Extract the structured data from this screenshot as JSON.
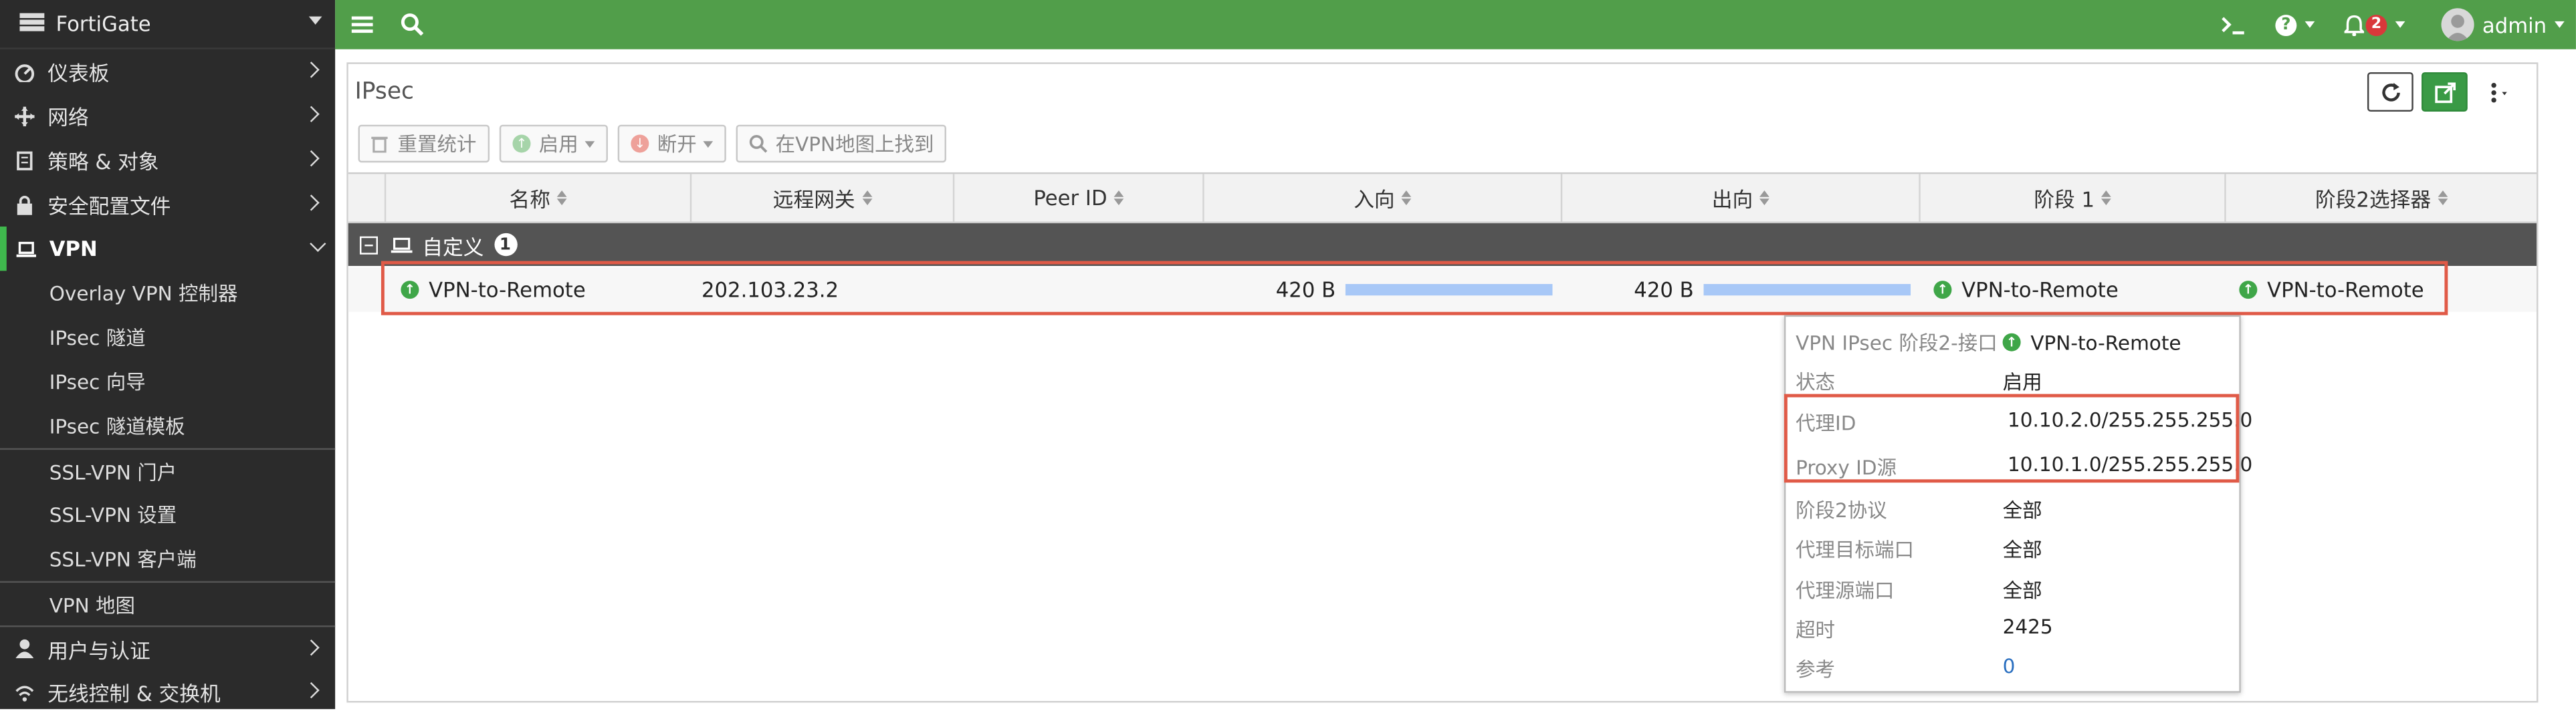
{
  "sidebar": {
    "brand": "FortiGate",
    "items": [
      {
        "label": "仪表板",
        "icon": "dashboard-icon"
      },
      {
        "label": "网络",
        "icon": "network-icon"
      },
      {
        "label": "策略 & 对象",
        "icon": "policy-icon"
      },
      {
        "label": "安全配置文件",
        "icon": "lock-icon"
      },
      {
        "label": "VPN",
        "icon": "laptop-icon"
      }
    ],
    "vpn_sub": [
      "Overlay VPN 控制器",
      "IPsec 隧道",
      "IPsec 向导",
      "IPsec 隧道模板",
      "SSL-VPN 门户",
      "SSL-VPN 设置",
      "SSL-VPN 客户端",
      "VPN 地图"
    ],
    "after": [
      {
        "label": "用户与认证",
        "icon": "user-icon"
      },
      {
        "label": "无线控制 & 交换机",
        "icon": "wifi-icon"
      }
    ]
  },
  "topbar": {
    "user": "admin",
    "alert_count": "2",
    "accent": "#519e4a"
  },
  "page": {
    "title": "IPsec",
    "toolbar": {
      "reset": "重置统计",
      "enable": "启用",
      "disconnect": "断开",
      "find": "在VPN地图上找到"
    }
  },
  "table": {
    "headers": [
      "名称",
      "远程网关",
      "Peer ID",
      "入向",
      "出向",
      "阶段 1",
      "阶段2选择器"
    ],
    "group": {
      "label": "自定义",
      "count": "1"
    },
    "row": {
      "name": "VPN-to-Remote",
      "gateway": "202.103.23.2",
      "peer_id": "",
      "in": "420 B",
      "out": "420 B",
      "phase1": "VPN-to-Remote",
      "phase2": "VPN-to-Remote"
    }
  },
  "popover": {
    "rows": [
      {
        "k": "VPN IPsec 阶段2-接口",
        "v": "VPN-to-Remote"
      },
      {
        "k": "状态",
        "v": "启用"
      },
      {
        "k": "代理ID",
        "v": "10.10.2.0/255.255.255.0"
      },
      {
        "k": "Proxy ID源",
        "v": "10.10.1.0/255.255.255.0"
      },
      {
        "k": "阶段2协议",
        "v": "全部"
      },
      {
        "k": "代理目标端口",
        "v": "全部"
      },
      {
        "k": "代理源端口",
        "v": "全部"
      },
      {
        "k": "超时",
        "v": "2425"
      },
      {
        "k": "参考",
        "v": "0"
      }
    ]
  }
}
